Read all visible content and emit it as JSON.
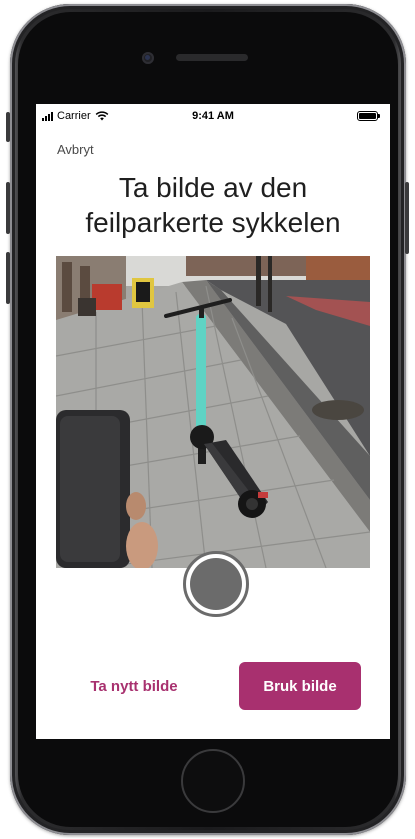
{
  "status_bar": {
    "carrier": "Carrier",
    "time": "9:41 AM",
    "icons": [
      "signal-bars-icon",
      "wifi-icon",
      "battery-icon"
    ]
  },
  "header": {
    "cancel_label": "Avbryt",
    "title_line1": "Ta bilde av den",
    "title_line2": "feilparkerte sykkelen"
  },
  "photo": {
    "icon": "scooter-photo"
  },
  "camera": {
    "shutter_icon": "shutter-icon"
  },
  "actions": {
    "retake_label": "Ta nytt bilde",
    "use_label": "Bruk bilde"
  },
  "colors": {
    "accent": "#a8306f",
    "shutter": "#6b6b6b",
    "text": "#1f1f1f"
  }
}
